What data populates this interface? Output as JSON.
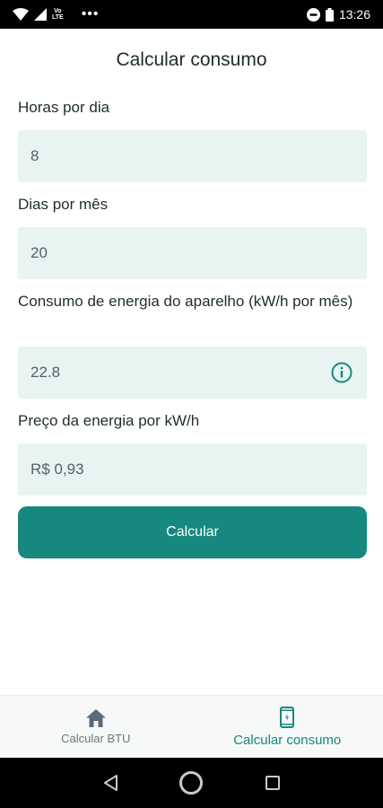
{
  "status_bar": {
    "volte_top": "Vo",
    "volte_bottom": "LTE",
    "more": "•••",
    "time": "13:26"
  },
  "page": {
    "title": "Calcular consumo"
  },
  "fields": {
    "hours_label": "Horas por dia",
    "hours_value": "8",
    "days_label": "Dias por mês",
    "days_value": "20",
    "consumption_label": "Consumo de energia do aparelho (kW/h por mês)",
    "consumption_value": "22.8",
    "price_label": "Preço da energia por kW/h",
    "price_value": "R$ 0,93"
  },
  "actions": {
    "calculate_label": "Calcular"
  },
  "bottom_nav": {
    "items": [
      {
        "label": "Calcular BTU",
        "icon": "home-icon",
        "active": false
      },
      {
        "label": "Calcular consumo",
        "icon": "phone-energy-icon",
        "active": true
      }
    ]
  },
  "colors": {
    "accent": "#17887e",
    "field_background": "#e8f4f2",
    "inactive_icon": "#5d6b77"
  }
}
